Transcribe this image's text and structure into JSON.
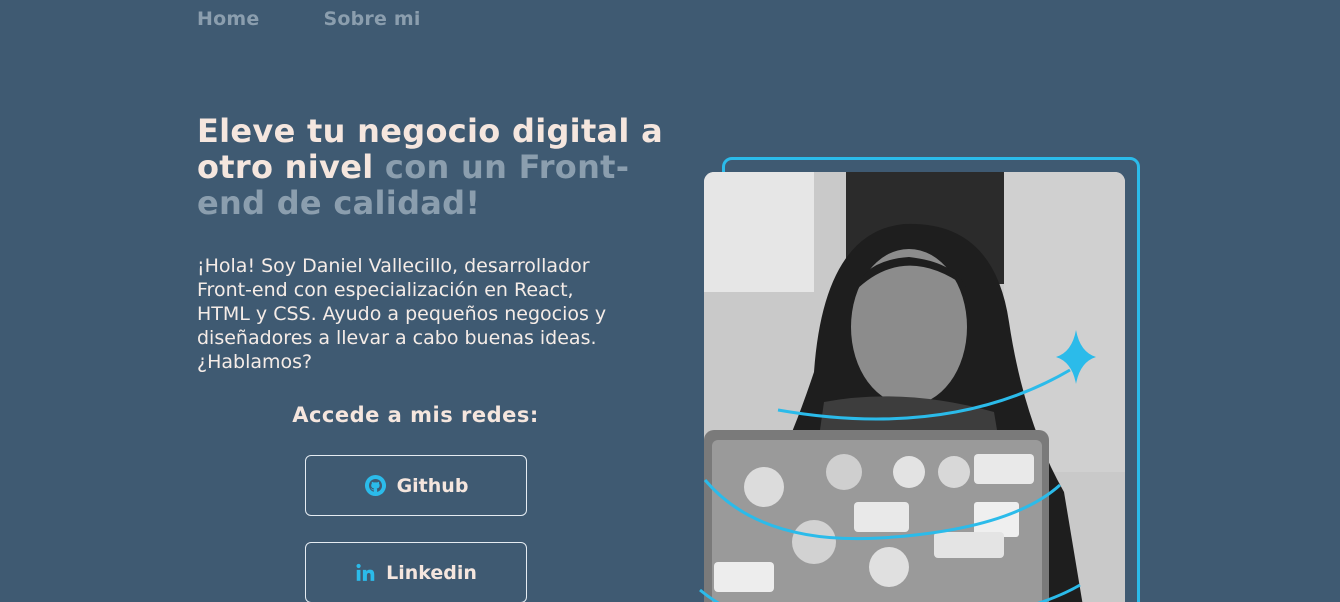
{
  "nav": {
    "items": [
      {
        "label": "Home"
      },
      {
        "label": "Sobre mi"
      }
    ]
  },
  "hero": {
    "headline_light": "Eleve tu negocio digital a otro nivel",
    "headline_muted": "con un Front-end de calidad!",
    "intro": "¡Hola! Soy Daniel Vallecillo, desarrollador Front-end con especialización en React, HTML y CSS. Ayudo a pequeños negocios y diseñadores a llevar a cabo buenas ideas. ¿Hablamos?"
  },
  "social": {
    "title": "Accede a mis redes:",
    "buttons": [
      {
        "label": "Github",
        "icon": "github-icon"
      },
      {
        "label": "Linkedin",
        "icon": "linkedin-icon"
      }
    ]
  },
  "colors": {
    "background": "#3f5a72",
    "accent": "#2bbbea",
    "text_light": "#f5e6de",
    "text_muted": "#8b9eae"
  }
}
